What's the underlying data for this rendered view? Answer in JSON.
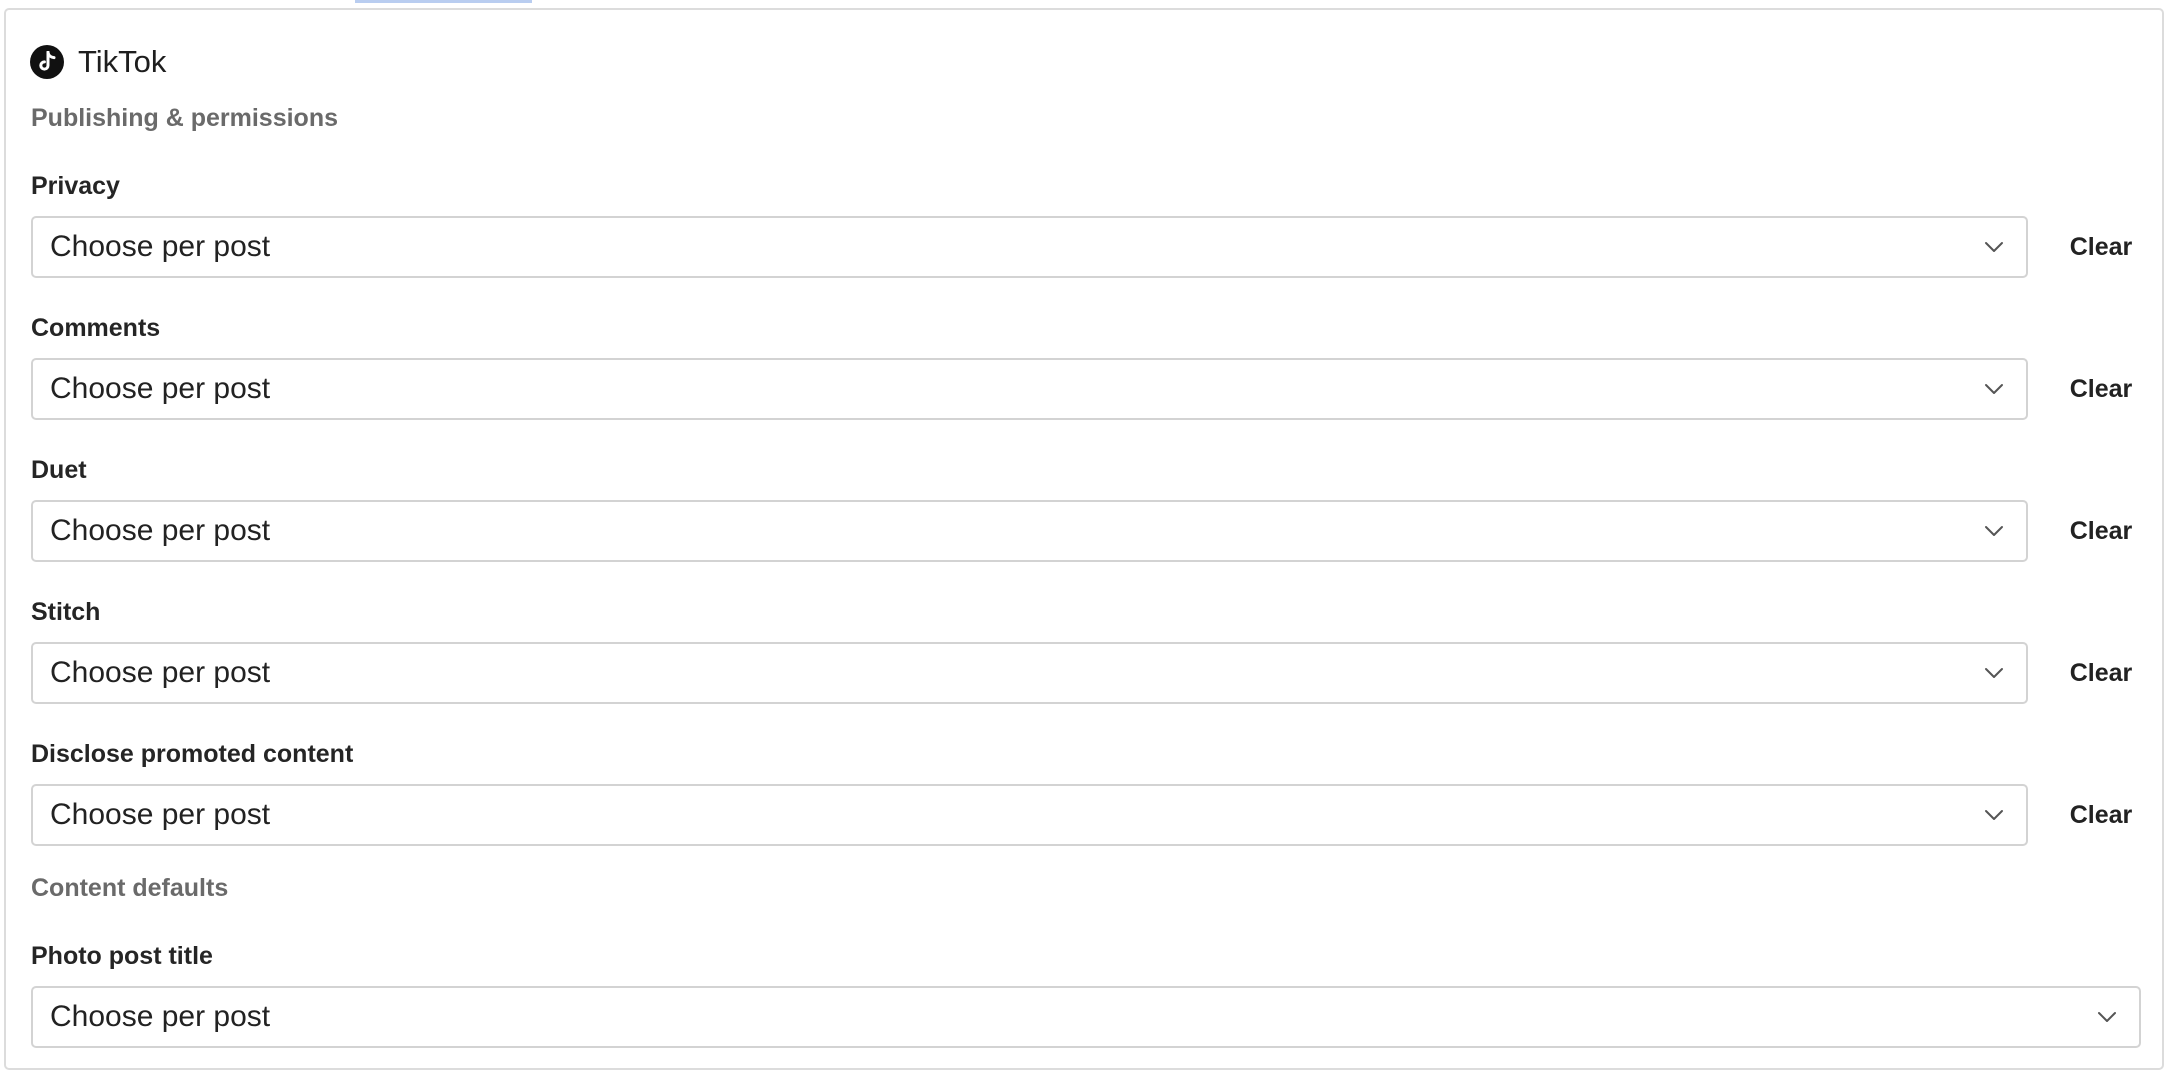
{
  "header": {
    "title": "TikTok",
    "icon": "tiktok-logo-icon"
  },
  "sections": {
    "publishing": "Publishing & permissions",
    "content_defaults": "Content defaults"
  },
  "fields": {
    "privacy": {
      "label": "Privacy",
      "value": "Choose per post",
      "clear_label": "Clear"
    },
    "comments": {
      "label": "Comments",
      "value": "Choose per post",
      "clear_label": "Clear"
    },
    "duet": {
      "label": "Duet",
      "value": "Choose per post",
      "clear_label": "Clear"
    },
    "stitch": {
      "label": "Stitch",
      "value": "Choose per post",
      "clear_label": "Clear"
    },
    "disclose": {
      "label": "Disclose promoted content",
      "value": "Choose per post",
      "clear_label": "Clear"
    },
    "photo_title": {
      "label": "Photo post title",
      "value": "Choose per post"
    }
  },
  "colors": {
    "border": "#d3d3d3",
    "section_heading": "#6a6a6a",
    "text": "#222222",
    "brand_icon_bg": "#111111",
    "top_accent": "#b9cdf0"
  }
}
